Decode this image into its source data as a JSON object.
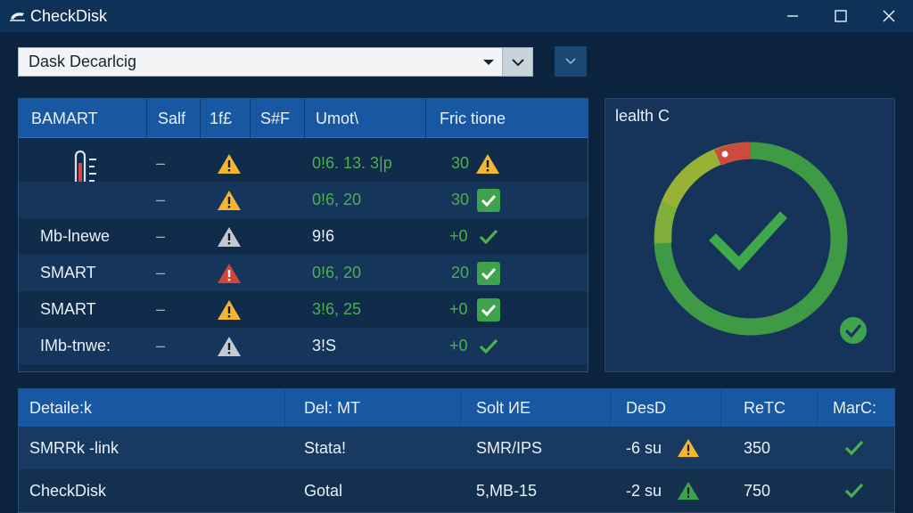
{
  "window": {
    "title": "CheckDisk",
    "app_icon": "disk-app-icon",
    "controls": [
      "minimize-icon",
      "maximize-icon",
      "close-icon"
    ]
  },
  "disk_select": {
    "value": "Dask Decarlcig",
    "options_visible": [
      "Dask Decarlcig"
    ]
  },
  "smart_table": {
    "headers": [
      "BAMART",
      "Salf",
      "1f£",
      "S#F",
      "Umot\\",
      "Fric tione"
    ],
    "rows": [
      {
        "name": "",
        "name_icon": "thermometer-icon",
        "dash": "–",
        "status_icon": "warning-yellow-icon",
        "value": "0!6. 13. 3|p",
        "result": "30",
        "result_icon": "warning-yellow-icon"
      },
      {
        "name": "",
        "name_icon": "",
        "dash": "–",
        "status_icon": "warning-yellow-icon",
        "value": "0!6, 20",
        "result": "30",
        "result_icon": "check-box-icon"
      },
      {
        "name": "Mb-lnewe",
        "name_icon": "",
        "dash": "–",
        "status_icon": "warning-gray-icon",
        "value": "9!6",
        "result": "+0",
        "result_icon": "check-icon"
      },
      {
        "name": "SMART",
        "name_icon": "",
        "dash": "–",
        "status_icon": "warning-red-icon",
        "value": "0!6, 20",
        "result": "20",
        "result_icon": "check-box-icon"
      },
      {
        "name": "SMART",
        "name_icon": "",
        "dash": "–",
        "status_icon": "warning-yellow-icon",
        "value": "3!6, 25",
        "result": "+0",
        "result_icon": "check-box-icon"
      },
      {
        "name": "IMb-tnwe:",
        "name_icon": "",
        "dash": "–",
        "status_icon": "warning-gray-icon",
        "value": "3!S",
        "result": "+0",
        "result_icon": "check-icon"
      }
    ]
  },
  "health": {
    "title": "lealth C",
    "gauge_icon": "health-ring-check-icon",
    "status_icon": "check-circle-icon"
  },
  "details_table": {
    "headers": [
      "Detaile:k",
      "Del: MT",
      "Solt ИE",
      "DesD",
      "ReTC",
      "MarC:"
    ],
    "rows": [
      {
        "name": "SMRRk -link",
        "del": "Stata!",
        "solt": "SMR/IPS",
        "des": "-6 su",
        "des_icon": "warning-yellow-icon",
        "ret": "350",
        "mark_icon": "check-icon"
      },
      {
        "name": "CheckDisk",
        "del": "Gotal",
        "solt": "5,MB-15",
        "des": "-2 su",
        "des_icon": "warning-green-icon",
        "ret": "750",
        "mark_icon": "check-icon"
      }
    ]
  },
  "colors": {
    "background": "#0c2340",
    "titlebar": "#0e3157",
    "header_blue": "#1858a3",
    "ok_green": "#4caf50",
    "warning_yellow": "#f1b733",
    "warning_red": "#d2453a",
    "warning_gray": "#c3cad3"
  }
}
